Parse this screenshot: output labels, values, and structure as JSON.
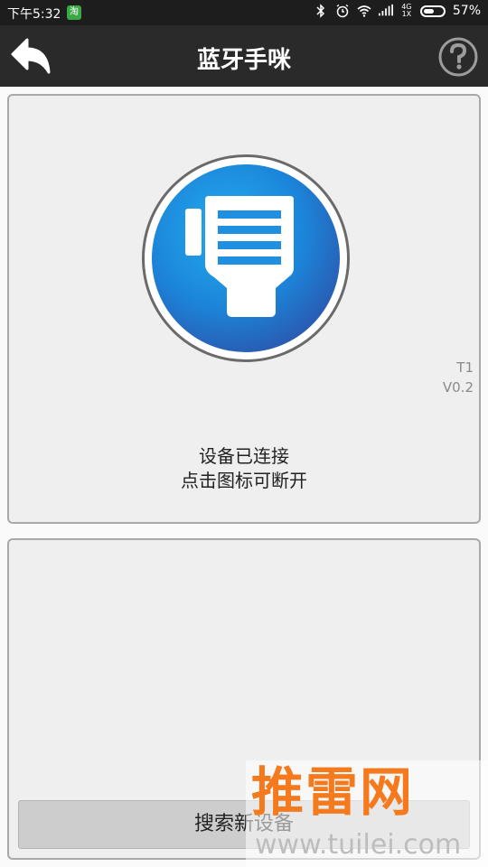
{
  "status_bar": {
    "time": "下午5:32",
    "app_icon_text": "淘",
    "network": "4G 1X",
    "battery_percent": "57%",
    "battery_level": 0.57
  },
  "header": {
    "title": "蓝牙手咪"
  },
  "device_panel": {
    "model": "T1",
    "version": "V0.2",
    "status_line1": "设备已连接",
    "status_line2": "点击图标可断开"
  },
  "search_panel": {
    "search_button_label": "搜索新设备"
  },
  "watermark": {
    "logo_text": "推雷网",
    "url_text": "www.tuilei.com"
  },
  "colors": {
    "accent_blue": "#1f8fe0",
    "watermark_orange": "#f57a1e"
  }
}
